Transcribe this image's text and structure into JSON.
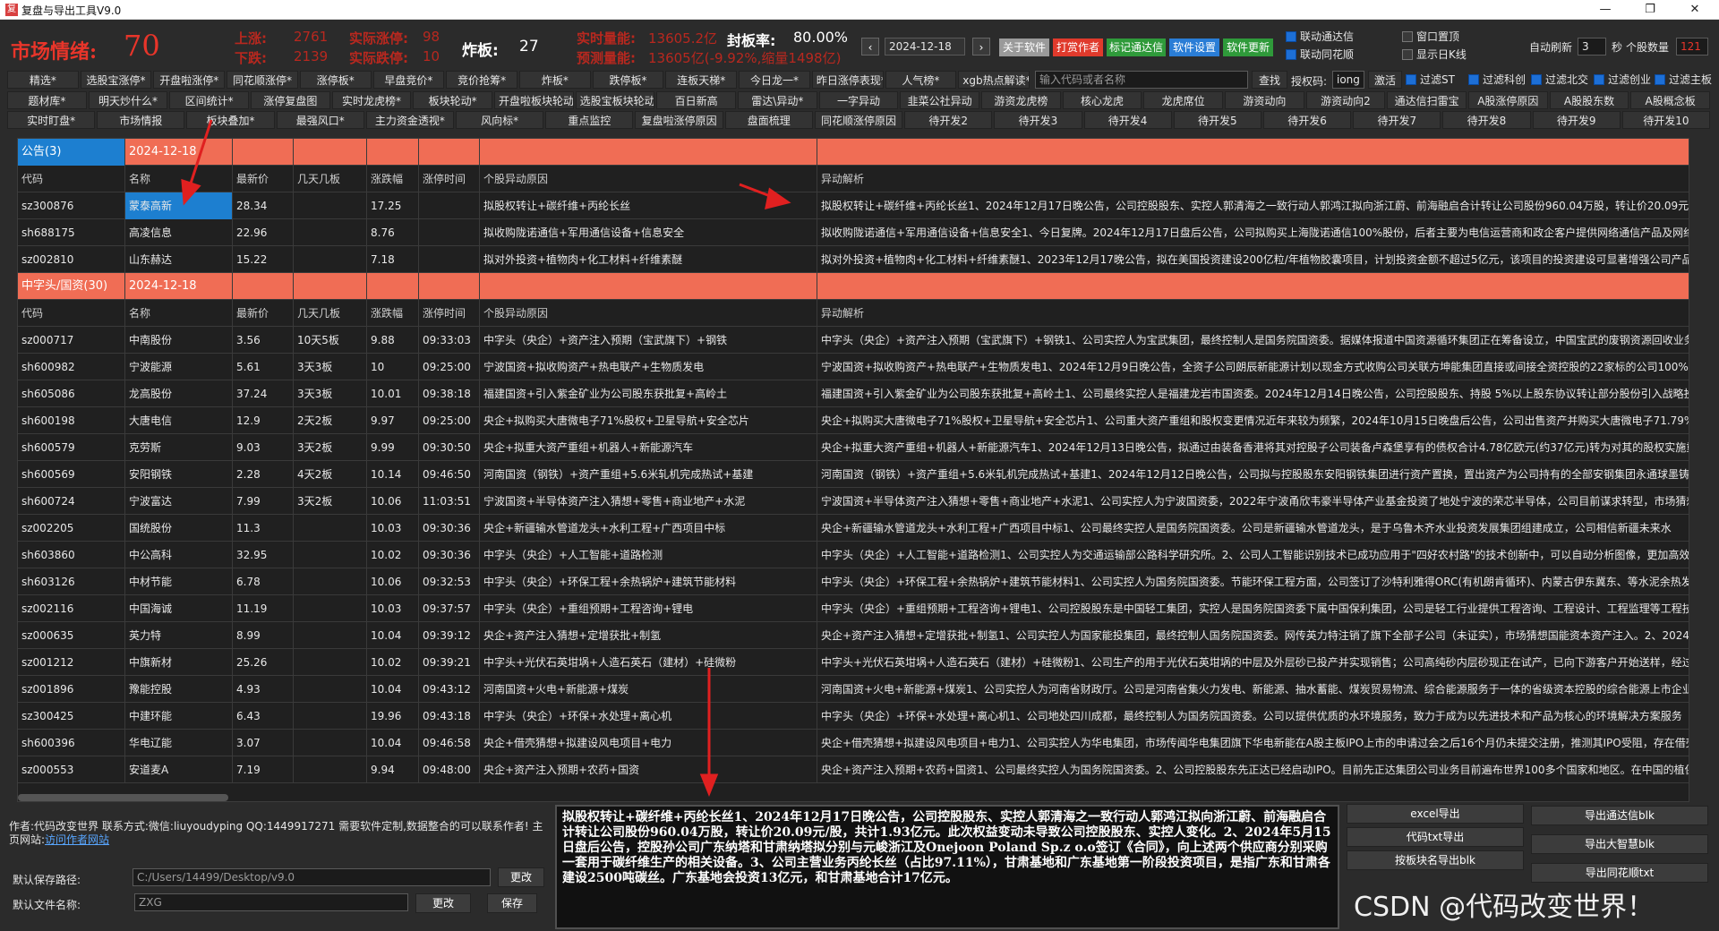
{
  "window": {
    "title": "复盘与导出工具V9.0",
    "icon_label": "复",
    "min": "—",
    "max": "❐",
    "close": "✕"
  },
  "header": {
    "sentiment_label": "市场情绪:",
    "sentiment_value": "70",
    "up_label": "上涨:",
    "up_value": "2761",
    "down_label": "下跌:",
    "down_value": "2139",
    "limit_up_label": "实际涨停:",
    "limit_up_value": "98",
    "limit_down_label": "实际跌停:",
    "limit_down_value": "10",
    "broken_label": "炸板:",
    "broken_value": "27",
    "volume_label": "实时量能:",
    "volume_value": "13605.2亿",
    "seal_rate_label": "封板率:",
    "seal_rate_value": "80.00%",
    "forecast_label": "预测量能:",
    "forecast_value": "13605亿(-9.92%,缩量1498亿)",
    "date": "2024-12-18",
    "prev_btn": "‹",
    "next_btn": "›",
    "buttons": [
      {
        "label": "关于软件",
        "color": "#9a9a9a"
      },
      {
        "label": "打赏作者",
        "color": "#e03a2c"
      },
      {
        "label": "标记通达信",
        "color": "#2f9a3a"
      },
      {
        "label": "软件设置",
        "color": "#2a7dd6"
      },
      {
        "label": "软件更新",
        "color": "#2f9a3a"
      }
    ],
    "linkage_tdx": "联动通达信",
    "linkage_ths": "联动同花顺",
    "window_top": "窗口置顶",
    "show_kline": "显示日K线",
    "auto_refresh_label": "自动刷新",
    "auto_refresh_value": "3",
    "seconds_label": "秒",
    "stock_count_label": "个股数量",
    "stock_count_value": "121"
  },
  "nav_row1": [
    "精选*",
    "选股宝涨停*",
    "开盘啦涨停*",
    "同花顺涨停*",
    "涨停板*",
    "早盘竞价*",
    "竞价抢筹*",
    "炸板*",
    "跌停板*",
    "连板天梯*",
    "今日龙一*",
    "昨日涨停表现*",
    "人气榜*",
    "xgb热点解读*"
  ],
  "search": {
    "placeholder": "输入代码或者名称",
    "button": "查找",
    "auth_label": "授权码:",
    "auth_value": "iong",
    "activate": "激活"
  },
  "filters": [
    "过滤ST",
    "过滤科创",
    "过滤北交",
    "过滤创业",
    "过滤主板"
  ],
  "nav_row2": [
    "题材库*",
    "明天炒什么*",
    "区间统计*",
    "涨停复盘图",
    "实时龙虎榜*",
    "板块轮动*",
    "开盘啦板块轮动",
    "选股宝板块轮动*",
    "百日新高",
    "雷达\\异动*",
    "一字异动",
    "韭菜公社异动",
    "游资龙虎榜",
    "核心龙虎",
    "龙虎席位",
    "游资动向",
    "游资动向2",
    "通达信扫雷宝",
    "A股涨停原因",
    "A股股东数",
    "A股概念板"
  ],
  "nav_row3": [
    "实时盯盘*",
    "市场情报",
    "板块叠加*",
    "最强风口*",
    "主力资金透视*",
    "风向标*",
    "重点监控",
    "复盘啦涨停原因",
    "盘面梳理",
    "同花顺涨停原因",
    "待开发2",
    "待开发3",
    "待开发4",
    "待开发5",
    "待开发6",
    "待开发7",
    "待开发8",
    "待开发9",
    "待开发10"
  ],
  "table": {
    "columns": [
      "代码",
      "名称",
      "最新价",
      "几天几板",
      "涨跌幅",
      "涨停时间",
      "个股异动原因",
      "异动解析"
    ],
    "sections": [
      {
        "title": "公告(3)",
        "date": "2024-12-18",
        "rows": [
          [
            "sz300876",
            "蒙泰高新",
            "28.34",
            "",
            "17.25",
            "",
            "拟股权转让+碳纤维+丙纶长丝",
            "拟股权转让+碳纤维+丙纶长丝1、2024年12月17日晚公告，公司控股股东、实控人郭清海之一致行动人郭鸿江拟向浙江蔚、前海融启合计转让公司股份960.04万股，转让价20.09元/"
          ],
          [
            "sh688175",
            "高凌信息",
            "22.96",
            "",
            "8.76",
            "",
            "拟收购陇诺通信+军用通信设备+信息安全",
            "拟收购陇诺通信+军用通信设备+信息安全1、今日复牌。2024年12月17日盘后公告，公司拟购买上海陇诺通信100%股份，后者主要为电信运营商和政企客户提供网络通信产品及网络"
          ],
          [
            "sz002810",
            "山东赫达",
            "15.22",
            "",
            "7.18",
            "",
            "拟对外投资+植物肉+化工材料+纤维素醚",
            "拟对外投资+植物肉+化工材料+纤维素醚1、2023年12月17晚公告，拟在美国投资建设200亿粒/年植物胶囊项目，计划投资金额不超过5亿元，该项目的投资建设可显著增强公司产品在"
          ]
        ]
      },
      {
        "title": "中字头/国资(30)",
        "date": "2024-12-18",
        "rows": [
          [
            "sz000717",
            "中南股份",
            "3.56",
            "10天5板",
            "9.88",
            "09:33:03",
            "中字头（央企）+资产注入预期（宝武旗下）+钢铁",
            "中字头（央企）+资产注入预期（宝武旗下）+钢铁1、公司实控人为宝武集团，最终控制人是国务院国资委。据媒体报道中国资源循环集团正在筹备设立，中国宝武的废钢资源回收业务"
          ],
          [
            "sh600982",
            "宁波能源",
            "5.61",
            "3天3板",
            "10",
            "09:25:00",
            "宁波国资+拟收购资产+热电联产+生物质发电",
            "宁波国资+拟收购资产+热电联产+生物质发电1、2024年12月9日晚公告，全资子公司朗辰新能源计划以现金方式收购公司关联方坤能集团直接或间接全资控股的22家标的公司100%股"
          ],
          [
            "sh605086",
            "龙高股份",
            "37.24",
            "3天3板",
            "10.01",
            "09:38:18",
            "福建国资+引入紫金矿业为公司股东获批复+高岭土",
            "福建国资+引入紫金矿业为公司股东获批复+高岭土1、公司最终实控人是福建龙岩市国资委。2024年12月14日晚公告，公司控股股东、持股 5%以上股东协议转让部分股份引入战略投"
          ],
          [
            "sh600198",
            "大唐电信",
            "12.9",
            "2天2板",
            "9.97",
            "09:25:00",
            "央企+拟购买大唐微电子71%股权+卫星导航+安全芯片",
            "央企+拟购买大唐微电子71%股权+卫星导航+安全芯片1、公司重大资产重组和股权变更情况近年来较为频繁，2024年10月15日晚盘后公告，公司出售资产并购买大唐微电子71.79%股权，"
          ],
          [
            "sh600579",
            "克劳斯",
            "9.03",
            "3天2板",
            "9.99",
            "09:30:50",
            "央企+拟重大资产重组+机器人+新能源汽车",
            "央企+拟重大资产重组+机器人+新能源汽车1、2024年12月13日晚公告，拟通过由装备香港将其对控股子公司装备卢森堡享有的债权合计4.78亿欧元(约37亿元)转为对其的股权实施重大"
          ],
          [
            "sh600569",
            "安阳钢铁",
            "2.28",
            "4天2板",
            "10.14",
            "09:46:50",
            "河南国资（钢铁）+资产重组+5.6米轧机完成热试+基建",
            "河南国资（钢铁）+资产重组+5.6米轧机完成热试+基建1、2024年12月12日晚公告，公司拟与控股股东安阳钢铁集团进行资产置换，置出资产为公司持有的全部安钢集团永通球墨铸铁"
          ],
          [
            "sh600724",
            "宁波富达",
            "7.99",
            "3天2板",
            "10.06",
            "11:03:51",
            "宁波国资+半导体资产注入猜想+零售+商业地产+水泥",
            "宁波国资+半导体资产注入猜想+零售+商业地产+水泥1、公司实控人为宁波国资委，2022年宁波甬欣韦豪半导体产业基金投资了地处宁波的荣芯半导体，公司目前谋求转型，市场猜想"
          ],
          [
            "sz002205",
            "国统股份",
            "11.3",
            "",
            "10.03",
            "09:30:36",
            "央企+新疆输水管道龙头+水利工程+广西项目中标",
            "央企+新疆输水管道龙头+水利工程+广西项目中标1、公司最终实控人是国务院国资委。公司是新疆输水管道龙头，是于乌鲁木齐水业投资发展集团组建成立，公司相信新疆未来水"
          ],
          [
            "sh603860",
            "中公高科",
            "32.95",
            "",
            "10.02",
            "09:30:36",
            "中字头（央企）+人工智能+道路检测",
            "中字头（央企）+人工智能+道路检测1、公司实控人为交通运输部公路科学研究所。2、公司人工智能识别技术已成功应用于\"四好农村路\"的技术创新中，可以自动分析图像，更加高效、"
          ],
          [
            "sh603126",
            "中材节能",
            "6.78",
            "",
            "10.06",
            "09:32:53",
            "中字头（央企）+环保工程+余热锅炉+建筑节能材料",
            "中字头（央企）+环保工程+余热锅炉+建筑节能材料1、公司实控人为国务院国资委。节能环保工程方面，公司签订了沙特利雅得ORC(有机朗肯循环)、内蒙古伊东冀东、等水泥余热发电"
          ],
          [
            "sz002116",
            "中国海诚",
            "11.19",
            "",
            "10.03",
            "09:37:57",
            "中字头（央企）+重组预期+工程咨询+锂电",
            "中字头（央企）+重组预期+工程咨询+锂电1、公司控股股东是中国轻工集团，实控人是国务院国资委下属中国保利集团，公司是轻工行业提供工程咨询、工程设计、工程监理等工程技"
          ],
          [
            "sz000635",
            "英力特",
            "8.99",
            "",
            "10.04",
            "09:39:12",
            "央企+资产注入猜想+定增获批+制氢",
            "央企+资产注入猜想+定增获批+制氢1、公司实控人为国家能投集团，最终控制人国务院国资委。网传英力特注销了旗下全部子公司（未证实），市场猜想国能资本资产注入。2、2024"
          ],
          [
            "sz001212",
            "中旗新材",
            "25.26",
            "",
            "10.02",
            "09:39:21",
            "中字头+光伏石英坩埚+人造石英石（建材）+硅微粉",
            "中字头+光伏石英坩埚+人造石英石（建材）+硅微粉1、公司生产的用于光伏石英坩埚的中层及外层砂已投产并实现销售；公司高纯砂内层砂现正在试产，已向下游客户开始送样，经过"
          ],
          [
            "sz001896",
            "豫能控股",
            "4.93",
            "",
            "10.04",
            "09:43:12",
            "河南国资+火电+新能源+煤炭",
            "河南国资+火电+新能源+煤炭1、公司实控人为河南省财政厅。公司是河南省集火力发电、新能源、抽水蓄能、煤炭贸易物流、综合能源服务于一体的省级资本控股的综合能源上市企业"
          ],
          [
            "sz300425",
            "中建环能",
            "6.43",
            "",
            "19.96",
            "09:43:18",
            "中字头（央企）+环保+水处理+离心机",
            "中字头（央企）+环保+水处理+离心机1、公司地处四川成都，最终控制人为国务院国资委。公司以提供优质的水环境服务，致力于成为以先进技术和产品为核心的环境解决方案服务"
          ],
          [
            "sh600396",
            "华电辽能",
            "3.07",
            "",
            "10.04",
            "09:46:58",
            "央企+借壳猜想+拟建设风电项目+电力",
            "央企+借壳猜想+拟建设风电项目+电力1、公司实控人为华电集团，市场传闻华电集团旗下华电新能在A股主板IPO上市的申请过会之后16个月仍未提交注册，推测其IPO受阻，存在借壳"
          ],
          [
            "sz000553",
            "安道麦A",
            "7.19",
            "",
            "9.94",
            "09:48:00",
            "央企+资产注入预期+农药+国资",
            "央企+资产注入预期+农药+国资1、公司最终实控人为国务院国资委。2、公司控股股东先正达已经启动IPO。目前先正达集团公司业务目前遍布世界100多个国家和地区。在中国的植保"
          ]
        ]
      }
    ]
  },
  "footer": {
    "author_line": "作者:代码改变世界 联系方式:微信:liuyoudyping QQ:1449917271 需要软件定制,数据整合的可以联系作者! 主页网站:",
    "author_link": "访问作者网站",
    "save_path_label": "默认保存路径:",
    "save_path_value": "C:/Users/14499/Desktop/v9.0",
    "change_path_btn": "更改",
    "file_name_label": "默认文件名称:",
    "file_name_value": "ZXG",
    "change_name_btn": "更改",
    "save_btn": "保存",
    "detail_text": "拟股权转让+碳纤维+丙纶长丝1、2024年12月17日晚公告，公司控股股东、实控人郭清海之一致行动人郭鸿江拟向浙江蔚、前海融启合计转让公司股份960.04万股，转让价20.09元/股，共计1.93亿元。此次权益变动未导致公司控股股东、实控人变化。2、2024年5月15日盘后公告，控股孙公司广东纳塔和甘肃纳塔拟分别与元峻浙江及Onejoon Poland Sp.z o.o签订《合同》，向上述两个供应商分别采购一套用于碳纤维生产的相关设备。3、公司主营业务丙纶长丝（占比97.11%），甘肃基地和广东基地第一阶段投资项目，是指广东和甘肃各建设2500吨碳丝。广东基地会投资13亿元，和甘肃基地合计17亿元。",
    "export_buttons_left": [
      "excel导出",
      "代码txt导出",
      "按板块名导出blk"
    ],
    "export_buttons_right": [
      "导出通达信blk",
      "导出大智慧blk",
      "导出同花顺txt"
    ],
    "watermark": "CSDN @代码改变世界！"
  },
  "colors": {
    "section_bar": "#f06d55",
    "selected_cell": "#1d7fd0",
    "accent_red": "#e8352a",
    "background": "#2b2b2b"
  }
}
